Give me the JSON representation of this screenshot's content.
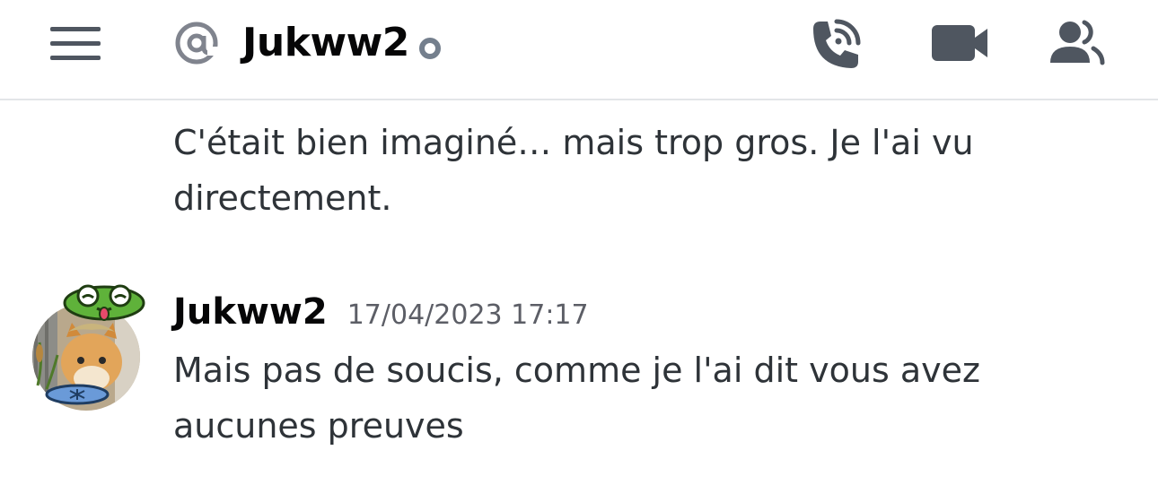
{
  "header": {
    "channel_name": "Jukww2",
    "icons": {
      "menu": "hamburger-menu-icon",
      "mention": "at-sign-icon",
      "status": "offline-status-icon",
      "call": "phone-call-icon",
      "video": "video-camera-icon",
      "members": "members-icon"
    }
  },
  "messages": [
    {
      "text": "C'était bien imaginé… mais trop gros. Je l'ai vu directement."
    },
    {
      "author": "Jukww2",
      "timestamp": "17/04/2023 17:17",
      "text": "Mais pas de soucis, comme je l'ai dit vous avez aucunes preuves"
    }
  ],
  "colors": {
    "header_icon": "#4f5660",
    "status_offline": "#747f8d",
    "text": "#2e3338",
    "muted": "#5c5e66",
    "divider": "#e3e5e8"
  }
}
